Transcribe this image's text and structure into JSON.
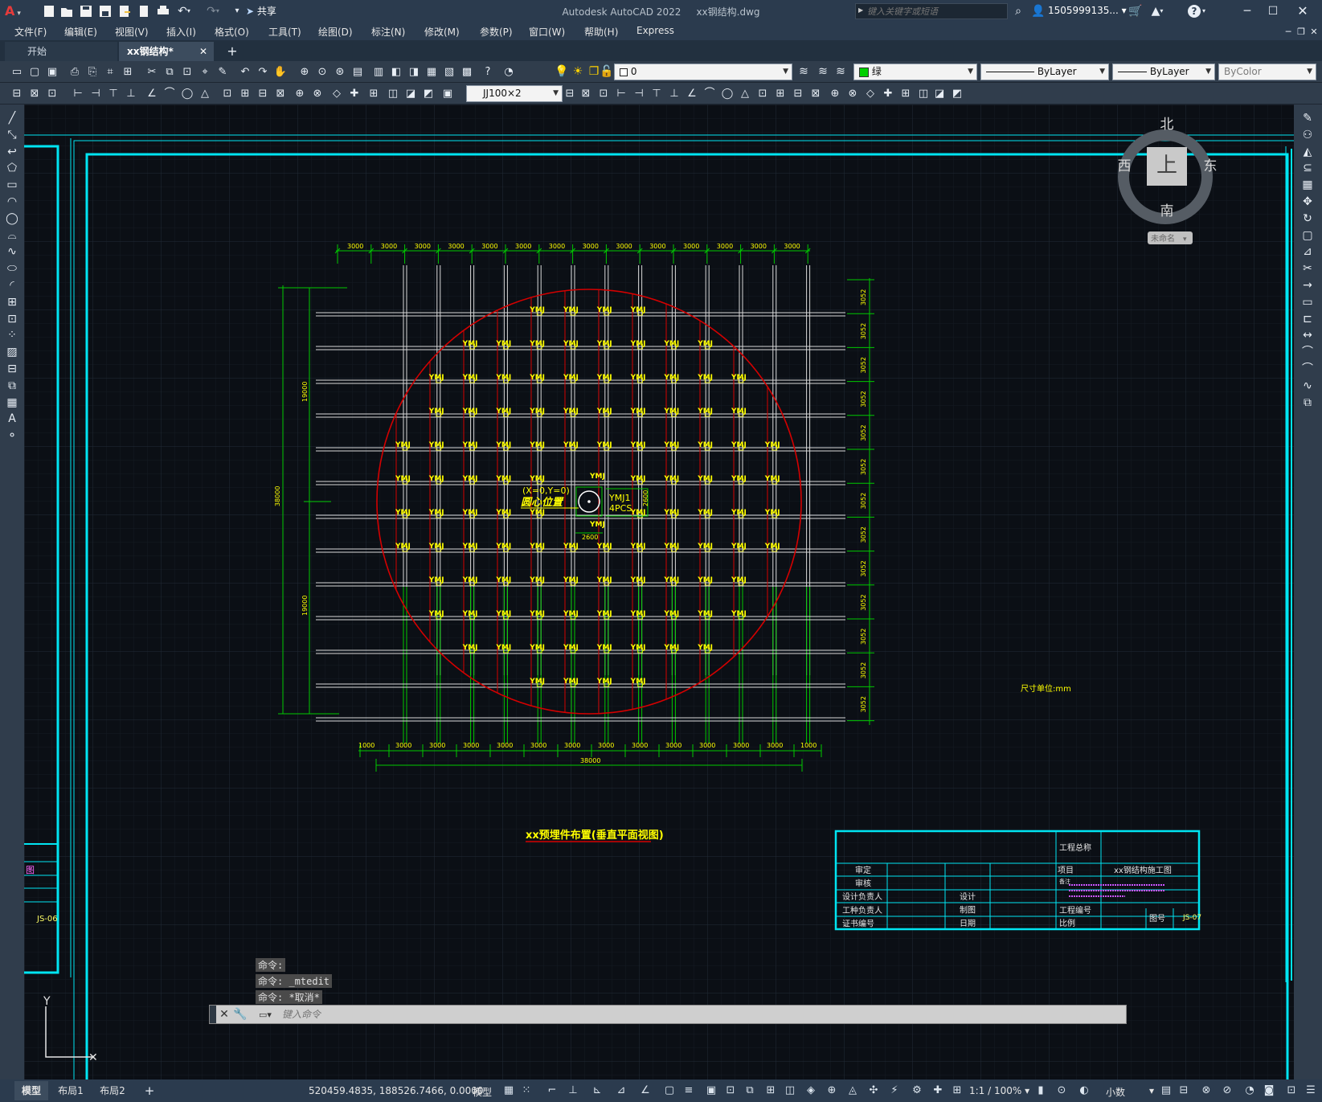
{
  "window": {
    "title": "Autodesk AutoCAD 2022",
    "file": "xx钢结构.dwg",
    "share": "共享",
    "search_placeholder": "键入关键字或短语",
    "user": "1505999135...",
    "app_icon": "A"
  },
  "menu": [
    "文件(F)",
    "编辑(E)",
    "视图(V)",
    "插入(I)",
    "格式(O)",
    "工具(T)",
    "绘图(D)",
    "标注(N)",
    "修改(M)",
    "参数(P)",
    "窗口(W)",
    "帮助(H)",
    "Express"
  ],
  "tabs": [
    {
      "label": "开始"
    },
    {
      "label": "xx钢结构*"
    }
  ],
  "toolbar": {
    "layer": "0",
    "color": "绿",
    "linetype": "ByLayer",
    "lineweight": "ByLayer",
    "plotstyle": "ByColor",
    "multiline_style": "JJ100×2"
  },
  "viewcube": {
    "north": "北",
    "south": "南",
    "east": "东",
    "west": "西",
    "top": "上",
    "ucs": "未命名"
  },
  "drawing": {
    "top_dims": [
      "3000",
      "3000",
      "3000",
      "3000",
      "3000",
      "3000",
      "3000",
      "3000",
      "3000",
      "3000",
      "3000",
      "3000",
      "3000",
      "3000"
    ],
    "bottom_dims": [
      "1000",
      "3000",
      "3000",
      "3000",
      "3000",
      "3000",
      "3000",
      "3000",
      "3000",
      "3000",
      "3000",
      "3000",
      "3000",
      "1000"
    ],
    "bottom_total": "38000",
    "left_total": "38000",
    "left_upper": "19000",
    "left_lower": "19000",
    "right_dims": [
      "3052",
      "3052",
      "3052",
      "3052",
      "3052",
      "3052",
      "3052",
      "3052",
      "3052",
      "3052",
      "3052",
      "3052",
      "3052"
    ],
    "grid_label": "YMJ",
    "center_coord": "(X=0,Y=0)",
    "center_label": "圆心位置",
    "callout_1": "YMJ1",
    "callout_2": "4PCS",
    "small_dim_1": "2600",
    "small_dim_2": "2600",
    "unit_note": "尺寸单位:mm",
    "view_title": "xx预埋件布置(垂直平面视图)"
  },
  "titleblock": {
    "project_name_label": "工程总称",
    "item_label": "项目",
    "item_value": "xx钢结构施工图",
    "note_label": "备注",
    "rows": [
      "审定",
      "审核",
      "设计负责人",
      "工种负责人",
      "证书编号"
    ],
    "mid": [
      "设计",
      "制图",
      "日期"
    ],
    "eng_no": "工程编号",
    "scale": "比例",
    "sheet_no": "图号",
    "sheet_code": "JS-07",
    "left_code": "JS-06",
    "left_label": "图"
  },
  "command": {
    "history": [
      "命令:",
      "命令: _mtedit",
      "命令: *取消*"
    ],
    "placeholder": "键入命令"
  },
  "layout_tabs": [
    "模型",
    "布局1",
    "布局2"
  ],
  "status": {
    "coords": "520459.4835, 188526.7466, 0.0000",
    "model": "模型",
    "scale": "1:1 / 100%",
    "units": "小数"
  },
  "colors": {
    "cyan": "#00e5f2",
    "green": "#00c800",
    "red": "#d40000",
    "yellow": "#ffff00",
    "grid": "#1b222c"
  }
}
